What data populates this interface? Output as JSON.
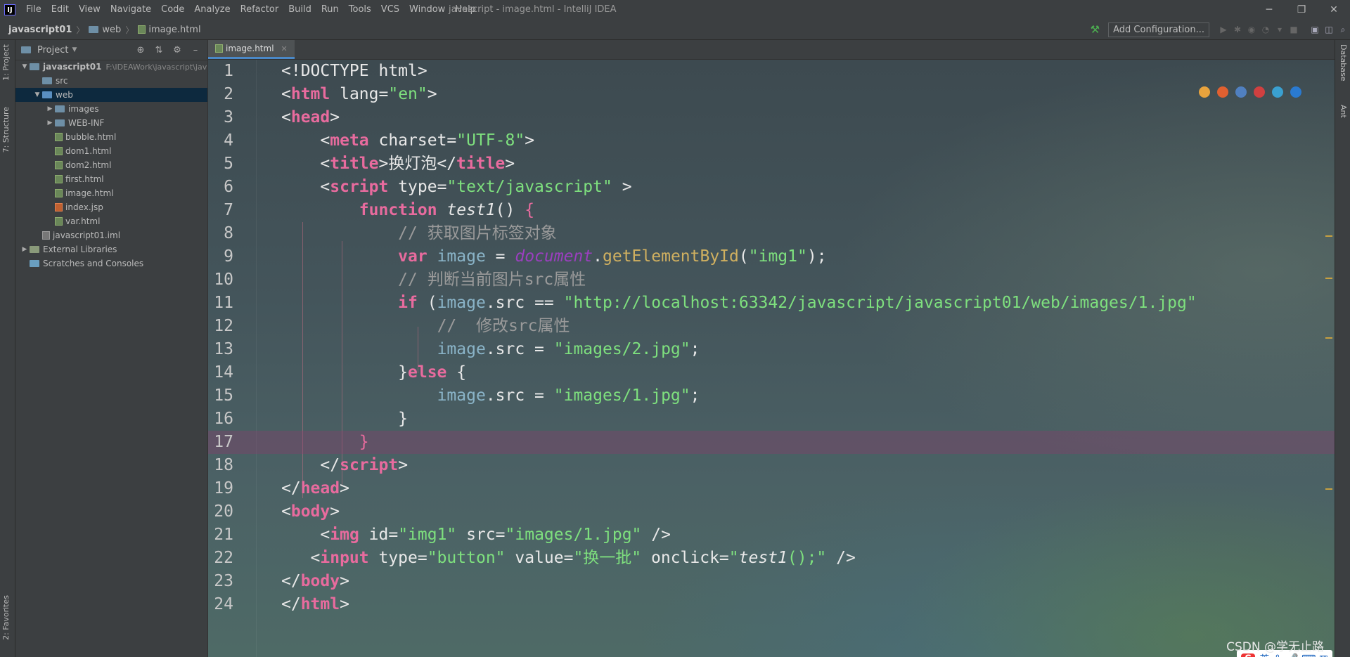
{
  "menu": {
    "items": [
      "File",
      "Edit",
      "View",
      "Navigate",
      "Code",
      "Analyze",
      "Refactor",
      "Build",
      "Run",
      "Tools",
      "VCS",
      "Window",
      "Help"
    ],
    "window_title": "javascript - image.html - IntelliJ IDEA",
    "app_icon": "IJ"
  },
  "breadcrumbs": [
    "javascript01",
    "web",
    "image.html"
  ],
  "toolbar": {
    "add_configuration": "Add Configuration..."
  },
  "left_tabs": {
    "project": "1: Project",
    "structure": "7: Structure",
    "favorites": "2: Favorites"
  },
  "right_tabs": {
    "database": "Database",
    "ant": "Ant"
  },
  "project_panel": {
    "title": "Project",
    "tree": [
      {
        "label": "javascript01",
        "path": "F:\\IDEAWork\\javascript\\jav",
        "type": "module",
        "depth": 0,
        "expanded": true
      },
      {
        "label": "src",
        "type": "folder",
        "depth": 1
      },
      {
        "label": "web",
        "type": "folder",
        "depth": 1,
        "expanded": true,
        "selected": true
      },
      {
        "label": "images",
        "type": "folder",
        "depth": 2,
        "collapsed": true
      },
      {
        "label": "WEB-INF",
        "type": "folder",
        "depth": 2,
        "collapsed": true
      },
      {
        "label": "bubble.html",
        "type": "file",
        "depth": 2
      },
      {
        "label": "dom1.html",
        "type": "file",
        "depth": 2
      },
      {
        "label": "dom2.html",
        "type": "file",
        "depth": 2
      },
      {
        "label": "first.html",
        "type": "file",
        "depth": 2
      },
      {
        "label": "image.html",
        "type": "file",
        "depth": 2
      },
      {
        "label": "index.jsp",
        "type": "jsp",
        "depth": 2
      },
      {
        "label": "var.html",
        "type": "file",
        "depth": 2
      },
      {
        "label": "javascript01.iml",
        "type": "iml",
        "depth": 1
      },
      {
        "label": "External Libraries",
        "type": "lib",
        "depth": 0,
        "collapsed": true
      },
      {
        "label": "Scratches and Consoles",
        "type": "scratch",
        "depth": 0
      }
    ]
  },
  "editor": {
    "tab": "image.html",
    "current_line": 17,
    "line_numbers": [
      "1",
      "2",
      "3",
      "4",
      "5",
      "6",
      "7",
      "8",
      "9",
      "10",
      "11",
      "12",
      "13",
      "14",
      "15",
      "16",
      "17",
      "18",
      "19",
      "20",
      "21",
      "22",
      "23",
      "24"
    ]
  },
  "ime": {
    "lang": "英",
    "symbols": "°, 🎤 ⌨ ▦"
  },
  "watermark": "CSDN @学无止路",
  "colors": {
    "keyword": "#e86b9e",
    "string": "#7ee07e",
    "comment": "#9a9a9a",
    "variable": "#8ab4c8",
    "document": "#9b3fbf",
    "method": "#d0b060"
  }
}
